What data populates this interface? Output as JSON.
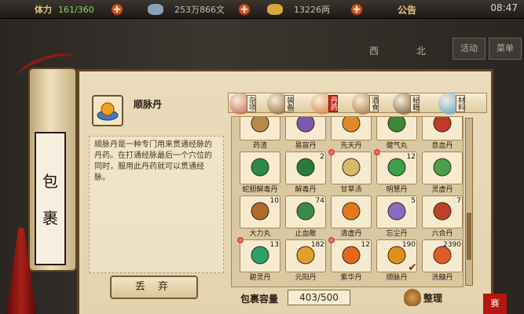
{
  "topbar": {
    "stamina_label": "体力",
    "stamina_value": "161/360",
    "silver_value": "253万866文",
    "gold_value": "13226两",
    "notice": "公告",
    "time": "08:47"
  },
  "scene": {
    "buttons": [
      "活动",
      "菜单"
    ],
    "map_chars": [
      "西",
      "北"
    ]
  },
  "scroll": {
    "title_chars": [
      "包",
      "裹"
    ]
  },
  "selected_item": {
    "name": "顺脉丹",
    "description": "顺脉丹是一种专门用来贯通经脉的丹药。在打通经脉最后一个穴位的同时，服用此丹药就可以贯通经脉。",
    "discard_label": "丢 弃"
  },
  "tabs": [
    {
      "label": "杂项",
      "color": "#c7583a"
    },
    {
      "label": "装备",
      "color": "#8a5a2a"
    },
    {
      "label": "丹药",
      "color": "#d8762a"
    },
    {
      "label": "酒食",
      "color": "#a6652e"
    },
    {
      "label": "秘籍",
      "color": "#6e4a2a"
    },
    {
      "label": "材料",
      "color": "#4aa3d8"
    }
  ],
  "items": [
    {
      "name": "药渣",
      "count": "",
      "color": "#b88a4a",
      "dot": false,
      "check": false
    },
    {
      "name": "易容丹",
      "count": "",
      "color": "#7a5ab0",
      "dot": false,
      "check": false
    },
    {
      "name": "先天丹",
      "count": "",
      "color": "#e08a2a",
      "dot": false,
      "check": false
    },
    {
      "name": "健气丸",
      "count": "",
      "color": "#3a8a3a",
      "dot": false,
      "check": false
    },
    {
      "name": "息血丹",
      "count": "",
      "color": "#c03a2a",
      "dot": false,
      "check": false
    },
    {
      "name": "蛇胆解毒丹",
      "count": "",
      "color": "#2a8a4a",
      "dot": false,
      "check": false
    },
    {
      "name": "解毒丹",
      "count": "2",
      "color": "#2a7a3a",
      "dot": false,
      "check": false
    },
    {
      "name": "甘草汤",
      "count": "",
      "color": "#d8b86a",
      "dot": true,
      "check": false
    },
    {
      "name": "明慧丹",
      "count": "12",
      "color": "#3aa04a",
      "dot": true,
      "check": false
    },
    {
      "name": "灵虚丹",
      "count": "",
      "color": "#4aa04a",
      "dot": false,
      "check": false
    },
    {
      "name": "大力丸",
      "count": "10",
      "color": "#b06a2a",
      "dot": false,
      "check": false
    },
    {
      "name": "止血散",
      "count": "74",
      "color": "#3a8a4a",
      "dot": false,
      "check": false
    },
    {
      "name": "清虚丹",
      "count": "",
      "color": "#e07a1a",
      "dot": false,
      "check": false
    },
    {
      "name": "忘尘丹",
      "count": "5",
      "color": "#8a6ac0",
      "dot": false,
      "check": false
    },
    {
      "name": "六合丹",
      "count": "7",
      "color": "#c0402a",
      "dot": false,
      "check": false
    },
    {
      "name": "碧灵丹",
      "count": "13",
      "color": "#2aa06a",
      "dot": true,
      "check": false
    },
    {
      "name": "元阳丹",
      "count": "182",
      "color": "#e0a02a",
      "dot": false,
      "check": false
    },
    {
      "name": "紫华丹",
      "count": "12",
      "color": "#e06a1a",
      "dot": true,
      "check": false
    },
    {
      "name": "顺脉丹",
      "count": "190",
      "color": "#e0901a",
      "dot": false,
      "check": true
    },
    {
      "name": "洗髓丹",
      "count": "2390",
      "color": "#e05a2a",
      "dot": false,
      "check": false
    }
  ],
  "footer": {
    "capacity_label": "包裹容量",
    "capacity_value": "403/500",
    "sort_label": "整理",
    "seal": "赛"
  }
}
